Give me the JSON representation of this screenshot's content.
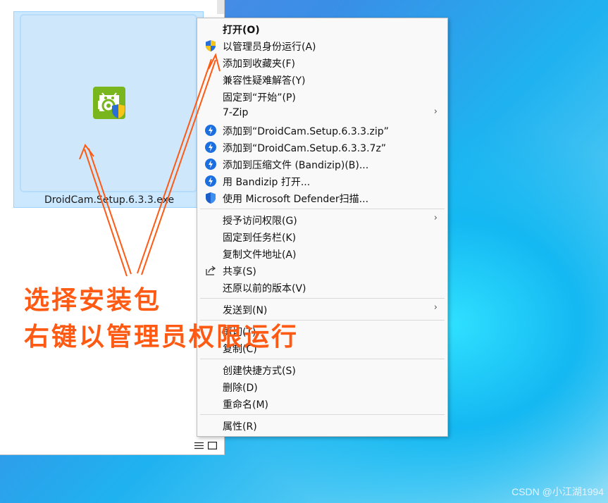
{
  "file": {
    "name": "DroidCam.Setup.6.3.3.exe"
  },
  "menu": {
    "items": [
      {
        "label": "打开(O)",
        "bold": true
      },
      {
        "label": "以管理员身份运行(A)",
        "icon": "uac-shield-icon"
      },
      {
        "label": "添加到收藏夹(F)"
      },
      {
        "label": "兼容性疑难解答(Y)"
      },
      {
        "label": "固定到“开始”(P)"
      },
      {
        "label": "7-Zip",
        "submenu": true
      },
      {
        "label": "添加到“DroidCam.Setup.6.3.3.zip”",
        "icon": "bandizip-icon"
      },
      {
        "label": "添加到“DroidCam.Setup.6.3.3.7z”",
        "icon": "bandizip-icon"
      },
      {
        "label": "添加到压缩文件 (Bandizip)(B)...",
        "icon": "bandizip-icon"
      },
      {
        "label": "用 Bandizip 打开...",
        "icon": "bandizip-icon"
      },
      {
        "label": "使用 Microsoft Defender扫描...",
        "icon": "defender-shield-icon"
      },
      {
        "label": "授予访问权限(G)",
        "submenu": true
      },
      {
        "label": "固定到任务栏(K)"
      },
      {
        "label": "复制文件地址(A)"
      },
      {
        "label": "共享(S)",
        "icon": "share-icon"
      },
      {
        "label": "还原以前的版本(V)"
      },
      {
        "label": "发送到(N)",
        "submenu": true
      },
      {
        "label": "剪切(T)"
      },
      {
        "label": "复制(C)"
      },
      {
        "label": "创建快捷方式(S)"
      },
      {
        "label": "删除(D)"
      },
      {
        "label": "重命名(M)"
      },
      {
        "label": "属性(R)"
      }
    ],
    "submenu_arrow": "›"
  },
  "annotation": {
    "line1": "选择安装包",
    "line2": "右键以管理员权限运行",
    "color": "#ff5a14"
  },
  "watermark": "CSDN @小江湖1994"
}
